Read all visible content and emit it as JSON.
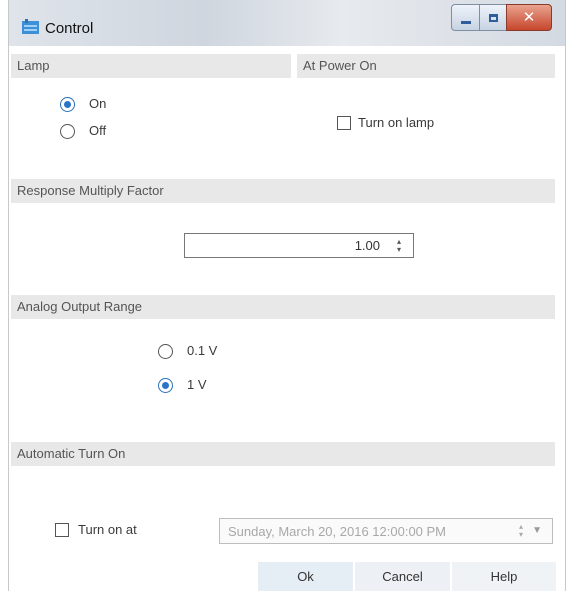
{
  "window": {
    "title": "Control",
    "app_icon": "control-app-icon"
  },
  "lamp": {
    "header": "Lamp",
    "options": [
      {
        "label": "On",
        "checked": true
      },
      {
        "label": "Off",
        "checked": false
      }
    ]
  },
  "power_on": {
    "header": "At Power On",
    "checkbox_label": "Turn on lamp",
    "checked": false
  },
  "response": {
    "header": "Response Multiply Factor",
    "value": "1.00"
  },
  "analog": {
    "header": "Analog Output Range",
    "options": [
      {
        "label": "0.1 V",
        "checked": false
      },
      {
        "label": "1 V",
        "checked": true
      }
    ]
  },
  "auto_on": {
    "header": "Automatic Turn On",
    "checkbox_label": "Turn on at",
    "checked": false,
    "datetime": "Sunday,  March 20, 2016  12:00:00 PM"
  },
  "buttons": {
    "ok": "Ok",
    "cancel": "Cancel",
    "help": "Help"
  },
  "colors": {
    "accent": "#2a74c8",
    "section_header_bg": "#e8e8e8",
    "close_button": "#c7462d"
  }
}
